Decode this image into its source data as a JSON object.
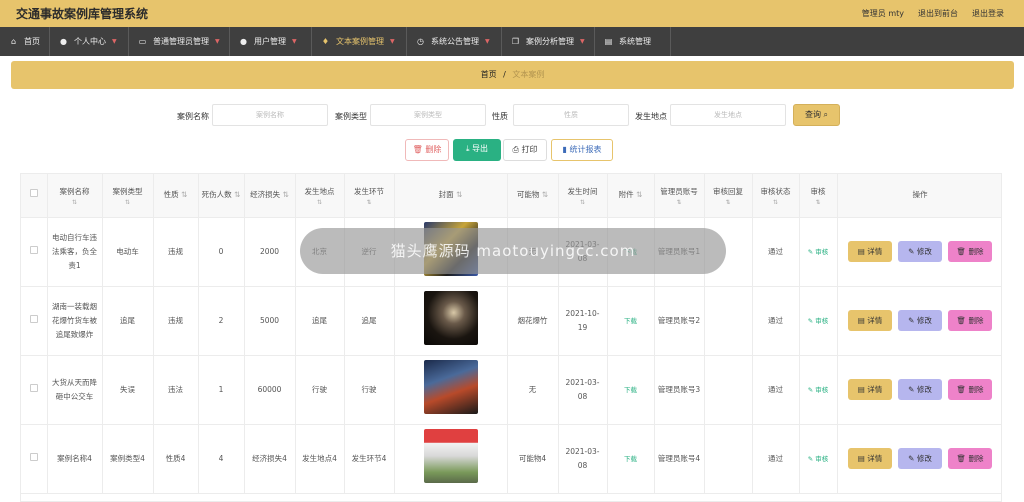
{
  "app": {
    "title": "交通事故案例库管理系统",
    "user_label": "管理员 mty",
    "to_front": "退出到前台",
    "logout": "退出登录"
  },
  "nav": [
    {
      "label": "首页",
      "icon": "home-icon"
    },
    {
      "label": "个人中心",
      "icon": "person-icon"
    },
    {
      "label": "普通管理员管理",
      "icon": "chat-icon"
    },
    {
      "label": "用户管理",
      "icon": "person-icon"
    },
    {
      "label": "文本案例管理",
      "icon": "pin-icon"
    },
    {
      "label": "系统公告管理",
      "icon": "clock-icon"
    },
    {
      "label": "案例分析管理",
      "icon": "copy-icon"
    },
    {
      "label": "系统管理",
      "icon": "doc-icon"
    }
  ],
  "breadcrumb": {
    "home": "首页",
    "sep": "/",
    "current": "文本案例"
  },
  "search": {
    "case_name_label": "案例名称",
    "case_name_placeholder": "案例名称",
    "case_type_label": "案例类型",
    "case_type_placeholder": "案例类型",
    "nature_label": "性质",
    "nature_placeholder": "性质",
    "location_label": "发生地点",
    "location_placeholder": "发生地点",
    "query_label": "查询"
  },
  "actions": {
    "delete": "删除",
    "export": "导出",
    "print": "打印",
    "stats": "统计报表"
  },
  "table": {
    "headers": [
      "案例名称",
      "案例类型",
      "性质",
      "死伤人数",
      "经济损失",
      "发生地点",
      "发生环节",
      "封面",
      "可能物",
      "发生时间",
      "附件",
      "管理员账号",
      "审核回复",
      "审核状态",
      "审核",
      "操作"
    ],
    "download": "下载",
    "review": "审核",
    "op_detail": "详情",
    "op_edit": "修改",
    "op_delete": "删除",
    "rows": [
      {
        "name": "电动自行车违法乘客，负全责1",
        "type": "电动车",
        "nature": "违规",
        "casualties": "0",
        "loss": "2000",
        "location": "北京",
        "stage": "逆行",
        "item": "无",
        "time": "2021-03-08",
        "admin": "管理员账号1",
        "status": "通过"
      },
      {
        "name": "湖南一装载烟花爆竹货车被追尾致爆炸",
        "type": "追尾",
        "nature": "违规",
        "casualties": "2",
        "loss": "5000",
        "location": "追尾",
        "stage": "追尾",
        "item": "烟花爆竹",
        "time": "2021-10-19",
        "admin": "管理员账号2",
        "status": "通过"
      },
      {
        "name": "大货从天而降砸中公交车",
        "type": "失误",
        "nature": "违法",
        "casualties": "1",
        "loss": "60000",
        "location": "行驶",
        "stage": "行驶",
        "item": "无",
        "time": "2021-03-08",
        "admin": "管理员账号3",
        "status": "通过"
      },
      {
        "name": "案例名称4",
        "type": "案例类型4",
        "nature": "性质4",
        "casualties": "4",
        "loss": "经济损失4",
        "location": "发生地点4",
        "stage": "发生环节4",
        "item": "可能物4",
        "time": "2021-03-08",
        "admin": "管理员账号4",
        "status": "通过"
      }
    ]
  },
  "overlay_text": "猫头鹰源码  maotouyingcc.com",
  "colors": {
    "accent": "#e7c46c",
    "nav_bg": "#3f3f3f",
    "export": "#2ab183",
    "edit": "#b6b6ee",
    "delete": "#ee82c9"
  }
}
